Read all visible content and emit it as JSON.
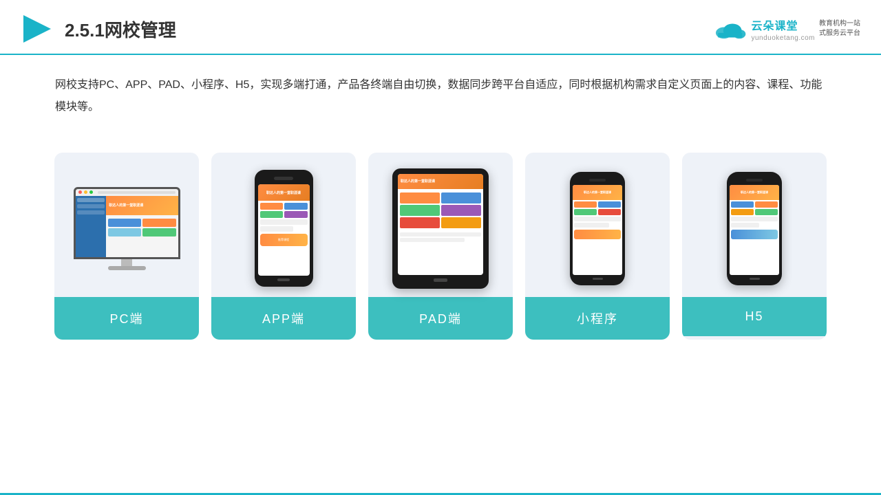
{
  "header": {
    "title": "2.5.1网校管理",
    "logo_name": "云朵课堂",
    "logo_url": "yunduoketang.com",
    "logo_slogan": "教育机构一站\n式服务云平台"
  },
  "description": {
    "text": "网校支持PC、APP、PAD、小程序、H5，实现多端打通，产品各终端自由切换，数据同步跨平台自适应，同时根据机构需求自定义页面上的内容、课程、功能模块等。"
  },
  "cards": [
    {
      "id": "pc",
      "label": "PC端"
    },
    {
      "id": "app",
      "label": "APP端"
    },
    {
      "id": "pad",
      "label": "PAD端"
    },
    {
      "id": "mini",
      "label": "小程序"
    },
    {
      "id": "h5",
      "label": "H5"
    }
  ],
  "colors": {
    "accent": "#1ab3c8",
    "card_bg": "#eef2f8",
    "card_label_bg": "#3dbfbf"
  }
}
